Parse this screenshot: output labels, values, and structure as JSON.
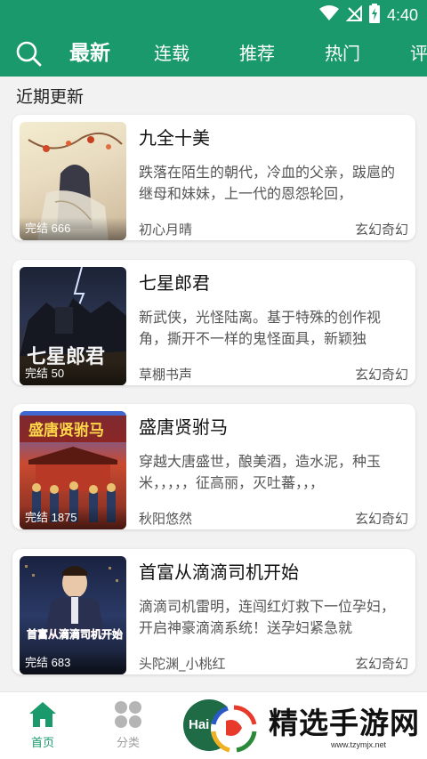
{
  "status_bar": {
    "time": "4:40"
  },
  "header": {
    "tabs": [
      {
        "label": "最新",
        "active": true
      },
      {
        "label": "连载",
        "active": false
      },
      {
        "label": "推荐",
        "active": false
      },
      {
        "label": "热门",
        "active": false
      },
      {
        "label": "评",
        "active": false
      }
    ]
  },
  "section": {
    "title": "近期更新"
  },
  "books": [
    {
      "title": "九全十美",
      "badge": "完结 666",
      "desc": "跌落在陌生的朝代，冷血的父亲，跋扈的继母和妹妹，上一代的恩怨轮回，",
      "author": "初心月晴",
      "genre": "玄幻奇幻"
    },
    {
      "title": "七星郎君",
      "badge": "完结 50",
      "desc": "新武侠，光怪陆离。基于特殊的创作视角，撕开不一样的鬼怪面具，新颖独",
      "author": "草棚书声",
      "genre": "玄幻奇幻",
      "cover_text": "七星郎君"
    },
    {
      "title": "盛唐贤驸马",
      "badge": "完结 1875",
      "desc": "穿越大唐盛世，酿美酒，造水泥，种玉米，，，，，征高丽，灭吐蕃，，，",
      "author": "秋阳悠然",
      "genre": "玄幻奇幻",
      "cover_text": "盛唐贤驸马"
    },
    {
      "title": "首富从滴滴司机开始",
      "badge": "完结 683",
      "desc": "滴滴司机雷明，连闯红灯救下一位孕妇，开启神豪滴滴系统！送孕妇紧急就",
      "author": "头陀渊_小桃红",
      "genre": "玄幻奇幻",
      "cover_text": "首富从滴滴司机开始"
    }
  ],
  "bottom_nav": {
    "items": [
      {
        "label": "首页",
        "icon": "home-icon",
        "active": true
      },
      {
        "label": "分类",
        "icon": "category-grid-icon",
        "active": false
      }
    ],
    "center_badge": "Hai"
  },
  "watermark": {
    "text": "精选手游网",
    "url": "www.tzymjx.net"
  },
  "colors": {
    "primary": "#1a9a6c",
    "background": "#f2f2f2",
    "card": "#ffffff",
    "nav_active": "#1a9a6c",
    "nav_inactive": "#9e9e9e"
  }
}
